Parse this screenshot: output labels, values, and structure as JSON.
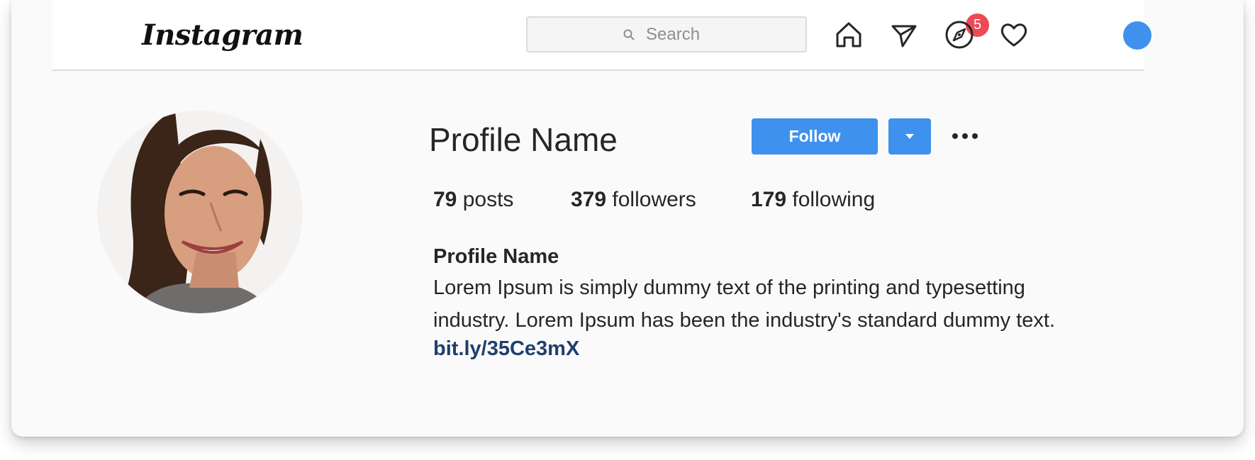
{
  "header": {
    "logo_text": "Instagram",
    "search_placeholder": "Search",
    "notification_count": "5",
    "icons": [
      "home-icon",
      "direct-message-icon",
      "explore-compass-icon",
      "activity-heart-icon",
      "user-avatar"
    ],
    "avatar_color": "#3e92ed"
  },
  "profile": {
    "username": "Profile Name",
    "follow_label": "Follow",
    "stats": {
      "posts_count": "79",
      "posts_label": "posts",
      "followers_count": "379",
      "followers_label": "followers",
      "following_count": "179",
      "following_label": "following"
    },
    "bio": {
      "name": "Profile Name",
      "line1": "Lorem Ipsum is simply dummy text of the printing and typesetting",
      "line2": "industry. Lorem Ipsum has been the industry's standard dummy text.",
      "link": "bit.ly/35Ce3mX"
    }
  },
  "colors": {
    "accent": "#3e92ed",
    "badge": "#ed4956",
    "link": "#1f3f6e",
    "background": "#fafafa"
  }
}
